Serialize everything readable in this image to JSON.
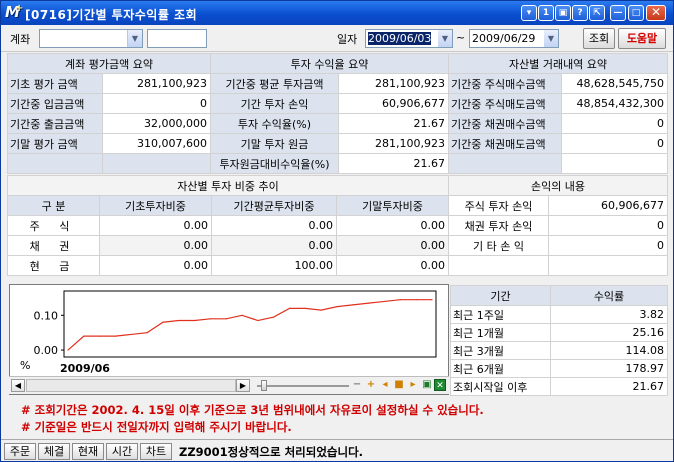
{
  "window": {
    "title": "[0716]기간별 투자수익률 조회",
    "buttons": [
      "▾",
      "1",
      "▣",
      "?",
      "⇱",
      "—",
      "□",
      "✕"
    ]
  },
  "query": {
    "account_label": "계좌",
    "date_label": "일자",
    "start_date": "2009/06/03",
    "date_sep": "~",
    "end_date": "2009/06/29",
    "search_button": "조회",
    "help_button": "도움말"
  },
  "eval_summary": {
    "header": "계좌 평가금액 요약",
    "rows": [
      {
        "label": "기초 평가  금액",
        "value": "281,100,923"
      },
      {
        "label": "기간중 입금금액",
        "value": "0"
      },
      {
        "label": "기간중 출금금액",
        "value": "32,000,000"
      },
      {
        "label": "기말 평가  금액",
        "value": "310,007,600"
      }
    ]
  },
  "return_summary": {
    "header": "투자 수익율 요약",
    "rows": [
      {
        "label": "기간중 평균 투자금액",
        "value": "281,100,923"
      },
      {
        "label": "기간 투자 손익",
        "value": "60,906,677"
      },
      {
        "label": "투자 수익율(%)",
        "value": "21.67"
      },
      {
        "label": "기말 투자 원금",
        "value": "281,100,923"
      },
      {
        "label": "투자원금대비수익율(%)",
        "value": "21.67"
      }
    ]
  },
  "trade_summary": {
    "header": "자산별 거래내역 요약",
    "rows": [
      {
        "label": "기간중 주식매수금액",
        "value": "48,628,545,750"
      },
      {
        "label": "기간중 주식매도금액",
        "value": "48,854,432,300"
      },
      {
        "label": "기간중 채권매수금액",
        "value": "0"
      },
      {
        "label": "기간중 채권매도금액",
        "value": "0"
      }
    ]
  },
  "weight_table": {
    "title": "자산별 투자 비중 추이",
    "col_headers": [
      "구  분",
      "기초투자비중",
      "기간평균투자비중",
      "기말투자비중"
    ],
    "rows": [
      {
        "label": "주 식",
        "values": [
          "0.00",
          "0.00",
          "0.00"
        ]
      },
      {
        "label": "채 권",
        "values": [
          "0.00",
          "0.00",
          "0.00"
        ]
      },
      {
        "label": "현 금",
        "values": [
          "0.00",
          "100.00",
          "0.00"
        ]
      }
    ]
  },
  "pnl_table": {
    "title": "손익의 내용",
    "rows": [
      {
        "label": "주식 투자 손익",
        "value": "60,906,677"
      },
      {
        "label": "채권 투자 손익",
        "value": "0"
      },
      {
        "label": "기 타  손 익",
        "value": "0"
      }
    ]
  },
  "period_table": {
    "col_headers": [
      "기간",
      "수익률"
    ],
    "rows": [
      {
        "label": "최근 1주일",
        "value": "3.82"
      },
      {
        "label": "최근 1개월",
        "value": "25.16"
      },
      {
        "label": "최근 3개월",
        "value": "114.08"
      },
      {
        "label": "최근 6개월",
        "value": "178.97"
      },
      {
        "label": "조회시작일 이후",
        "value": "21.67"
      }
    ]
  },
  "chart_data": {
    "type": "line",
    "y_unit": "%",
    "x_label": "2009/06",
    "y_ticks": [
      "0.10",
      "0.00"
    ],
    "ylim": [
      -0.02,
      0.17
    ],
    "series": [
      {
        "color": "#e0301e",
        "values": [
          0.0,
          0.04,
          0.04,
          0.04,
          0.045,
          0.05,
          0.08,
          0.085,
          0.085,
          0.09,
          0.09,
          0.1,
          0.085,
          0.095,
          0.12,
          0.12,
          0.115,
          0.125,
          0.13,
          0.135,
          0.14,
          0.145,
          0.145,
          0.145
        ]
      }
    ]
  },
  "chart_toolbar": {
    "icons": [
      "minus-icon",
      "plus-icon",
      "prev-icon",
      "stop-icon",
      "next-icon",
      "excel-icon"
    ]
  },
  "notes": [
    "# 조회기간은 2002. 4. 15일 이후 기준으로 3년 범위내에서 자유로이 설정하실 수 있습니다.",
    "# 기준일은 반드시 전일자까지 입력해 주시기 바랍니다."
  ],
  "statusbar": {
    "buttons": [
      "주문",
      "체결",
      "현재",
      "시간",
      "차트"
    ],
    "message": "ZZ9001정상적으로 처리되었습니다."
  }
}
